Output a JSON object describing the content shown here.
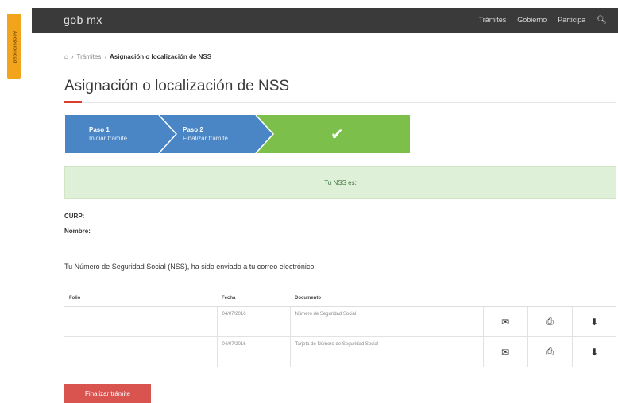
{
  "header": {
    "logo": "gob mx",
    "nav": [
      "Trámites",
      "Gobierno",
      "Participa"
    ],
    "search_icon": "search-icon"
  },
  "side_tab": {
    "label": "Accesibilidad"
  },
  "breadcrumb": {
    "home_icon": "home-icon",
    "items": [
      "Trámites",
      "Asignación o localización de NSS"
    ]
  },
  "page": {
    "title": "Asignación o localización de NSS"
  },
  "stepper": {
    "steps": [
      {
        "title": "Paso 1",
        "subtitle": "Iniciar trámite"
      },
      {
        "title": "Paso 2",
        "subtitle": "Finalizar trámite"
      }
    ],
    "done_icon": "check-icon",
    "colors": {
      "step": "#4a86c6",
      "done": "#7cbf4a"
    }
  },
  "alert": {
    "text": "Tu NSS es:"
  },
  "fields": {
    "curp_label": "CURP:",
    "nombre_label": "Nombre:"
  },
  "message": "Tu Número de Seguridad Social (NSS), ha sido enviado a tu correo electrónico.",
  "table": {
    "headers": [
      "Folio",
      "Fecha",
      "Documento"
    ],
    "rows": [
      {
        "folio": "",
        "fecha": "04/07/2016",
        "documento": "Número de Seguridad Social"
      },
      {
        "folio": "",
        "fecha": "04/07/2016",
        "documento": "Tarjeta de Número de Seguridad Social"
      }
    ],
    "row_icons": [
      "email-icon",
      "print-icon",
      "download-icon"
    ]
  },
  "actions": {
    "finish_label": "Finalizar trámite",
    "finish_color": "#d9534f"
  }
}
